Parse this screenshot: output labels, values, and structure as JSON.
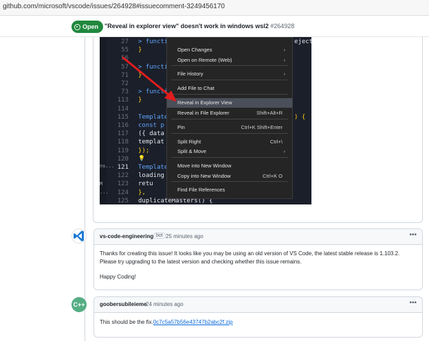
{
  "browser": {
    "url": "github.com/microsoft/vscode/issues/264928#issuecomment-3249456170"
  },
  "issue": {
    "state": "Open",
    "title": "\"Reveal in explorer view\" doesn't work in windows wsl2",
    "number": "#264928"
  },
  "screenshot_editor": {
    "lines": [
      {
        "n": "27",
        "code": "> function"
      },
      {
        "n": "55",
        "code": "}"
      },
      {
        "n": "56",
        "code": ""
      },
      {
        "n": "57",
        "code": "> function"
      },
      {
        "n": "71",
        "code": "}"
      },
      {
        "n": "72",
        "code": ""
      },
      {
        "n": "73",
        "code": "> function"
      },
      {
        "n": "113",
        "code": "}"
      },
      {
        "n": "114",
        "code": ""
      },
      {
        "n": "115",
        "code": "Template"
      },
      {
        "n": "116",
        "code": "  const p"
      },
      {
        "n": "117",
        "code": "  ({ data"
      },
      {
        "n": "118",
        "code": "  templat"
      },
      {
        "n": "119",
        "code": "});"
      },
      {
        "n": "120",
        "code": ""
      },
      {
        "n": "121",
        "code": "Template"
      },
      {
        "n": "122",
        "code": "  loading"
      },
      {
        "n": "123",
        "code": "    retu"
      },
      {
        "n": "124",
        "code": "  },"
      },
      {
        "n": "125",
        "code": "  duplicateMasters() {"
      }
    ],
    "right_fragments": [
      "ejecte",
      ") {"
    ],
    "left_strip": [
      "ns...",
      "M",
      "..."
    ]
  },
  "context_menu": {
    "items": [
      {
        "label": "Open Changes",
        "shortcut": "",
        "submenu": true
      },
      {
        "label": "Open on Remote (Web)",
        "shortcut": "",
        "submenu": true
      },
      {
        "label": "File History",
        "shortcut": "",
        "submenu": true
      },
      {
        "label": "Add File to Chat",
        "shortcut": "",
        "submenu": false
      },
      {
        "label": "Reveal in Explorer View",
        "shortcut": "",
        "submenu": false,
        "selected": true
      },
      {
        "label": "Reveal in File Explorer",
        "shortcut": "Shift+Alt+R",
        "submenu": false
      },
      {
        "label": "Pin",
        "shortcut": "Ctrl+K Shift+Enter",
        "submenu": false
      },
      {
        "label": "Split Right",
        "shortcut": "Ctrl+\\",
        "submenu": false
      },
      {
        "label": "Split & Move",
        "shortcut": "",
        "submenu": true
      },
      {
        "label": "Move into New Window",
        "shortcut": "",
        "submenu": false
      },
      {
        "label": "Copy into New Window",
        "shortcut": "Ctrl+K O",
        "submenu": false
      },
      {
        "label": "Find File References",
        "shortcut": "",
        "submenu": false
      }
    ]
  },
  "comments": [
    {
      "author": "vs-code-engineering",
      "badge": "bot",
      "time": "25 minutes ago",
      "paragraphs": [
        "Thanks for creating this issue! It looks like you may be using an old version of VS Code, the latest stable release is 1.103.2. Please try upgrading to the latest version and checking whether this issue remains.",
        "Happy Coding!"
      ]
    },
    {
      "author": "goobersubileieme",
      "time": "24 minutes ago",
      "text_prefix": "This should be the fix.",
      "link": "0c7c5a57b56e43747b2abc2f.zip"
    }
  ],
  "colors": {
    "open_green": "#1f883d",
    "link_blue": "#0969da",
    "editor_bg": "#1b1f2a",
    "menu_bg": "#252526",
    "annotation_red": "#e11d1d"
  },
  "icons": [
    "issue-open-icon",
    "vscode-logo-icon",
    "cpp-avatar-icon",
    "kebab-menu-icon",
    "submenu-chevron-icon",
    "lightbulb-icon"
  ]
}
